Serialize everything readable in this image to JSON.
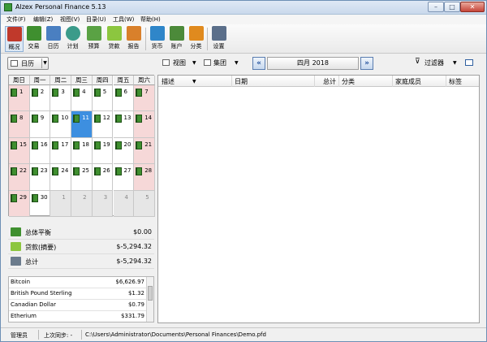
{
  "app": {
    "title": "Alzex Personal Finance 5.13"
  },
  "window_controls": {
    "minimize": "–",
    "maximize": "□",
    "close": "✕"
  },
  "menu": [
    "文件(F)",
    "编辑(Z)",
    "视图(V)",
    "目录(U)",
    "工具(W)",
    "帮助(H)"
  ],
  "toolbar": [
    {
      "label": "概况",
      "icon": "overview-icon",
      "color": "#c0392b"
    },
    {
      "label": "交易",
      "icon": "transactions-book-icon",
      "color": "#3f8f2f"
    },
    {
      "label": "日历",
      "icon": "calendar-icon",
      "color": "#4a7fc1"
    },
    {
      "label": "计划",
      "icon": "plan-clock-icon",
      "color": "#3b9b8a"
    },
    {
      "label": "预算",
      "icon": "budget-money-icon",
      "color": "#5aa244"
    },
    {
      "label": "贷款",
      "icon": "loan-icon",
      "color": "#8cc63f"
    },
    {
      "label": "报告",
      "icon": "report-chart-icon",
      "color": "#d9802b"
    },
    {
      "label": "货币",
      "icon": "currency-exchange-icon",
      "color": "#2f86c9"
    },
    {
      "label": "账户",
      "icon": "accounts-icon",
      "color": "#4c8a3a"
    },
    {
      "label": "分类",
      "icon": "categories-icon",
      "color": "#e08a1e"
    },
    {
      "label": "设置",
      "icon": "settings-icon",
      "color": "#5b6f8a"
    }
  ],
  "subbar": {
    "view_mode": "日历",
    "view_menu": "视图",
    "group_menu": "集团",
    "prev": "«",
    "next": "»",
    "month": "四月 2018",
    "filter": "过滤器"
  },
  "calendar": {
    "weekdays": [
      "周日",
      "周一",
      "周二",
      "周三",
      "周四",
      "周五",
      "周六"
    ],
    "weeks": [
      [
        "1",
        "2",
        "3",
        "4",
        "5",
        "6",
        "7"
      ],
      [
        "8",
        "9",
        "10",
        "11",
        "12",
        "13",
        "14"
      ],
      [
        "15",
        "16",
        "17",
        "18",
        "19",
        "20",
        "21"
      ],
      [
        "22",
        "23",
        "24",
        "25",
        "26",
        "27",
        "28"
      ],
      [
        "29",
        "30",
        "1",
        "2",
        "3",
        "4",
        "5"
      ]
    ],
    "today": "11"
  },
  "summary": [
    {
      "label": "总体平衡",
      "value": "$0.00",
      "icon": "balance-sheet-icon",
      "color": "#3f8f2f"
    },
    {
      "label": "贷款(摘要)",
      "value": "$-5,294.32",
      "icon": "loan-summary-icon",
      "color": "#8cc63f"
    },
    {
      "label": "总计",
      "value": "$-5,294.32",
      "icon": "scale-icon",
      "color": "#6b7b8c"
    }
  ],
  "currencies": [
    {
      "name": "Bitcoin",
      "value": "$6,626.97"
    },
    {
      "name": "British Pound Sterling",
      "value": "$1.32"
    },
    {
      "name": "Canadian Dollar",
      "value": "$0.79"
    },
    {
      "name": "Etherium",
      "value": "$331.79"
    }
  ],
  "transactions": {
    "columns": [
      "描述",
      "日期",
      "总计",
      "分类",
      "家庭成员",
      "标签"
    ]
  },
  "status": {
    "user": "管理员",
    "last_sync": "上次同步: -",
    "path": "C:\\Users\\Administrator\\Documents\\Personal Finances\\Demo.pfd"
  }
}
